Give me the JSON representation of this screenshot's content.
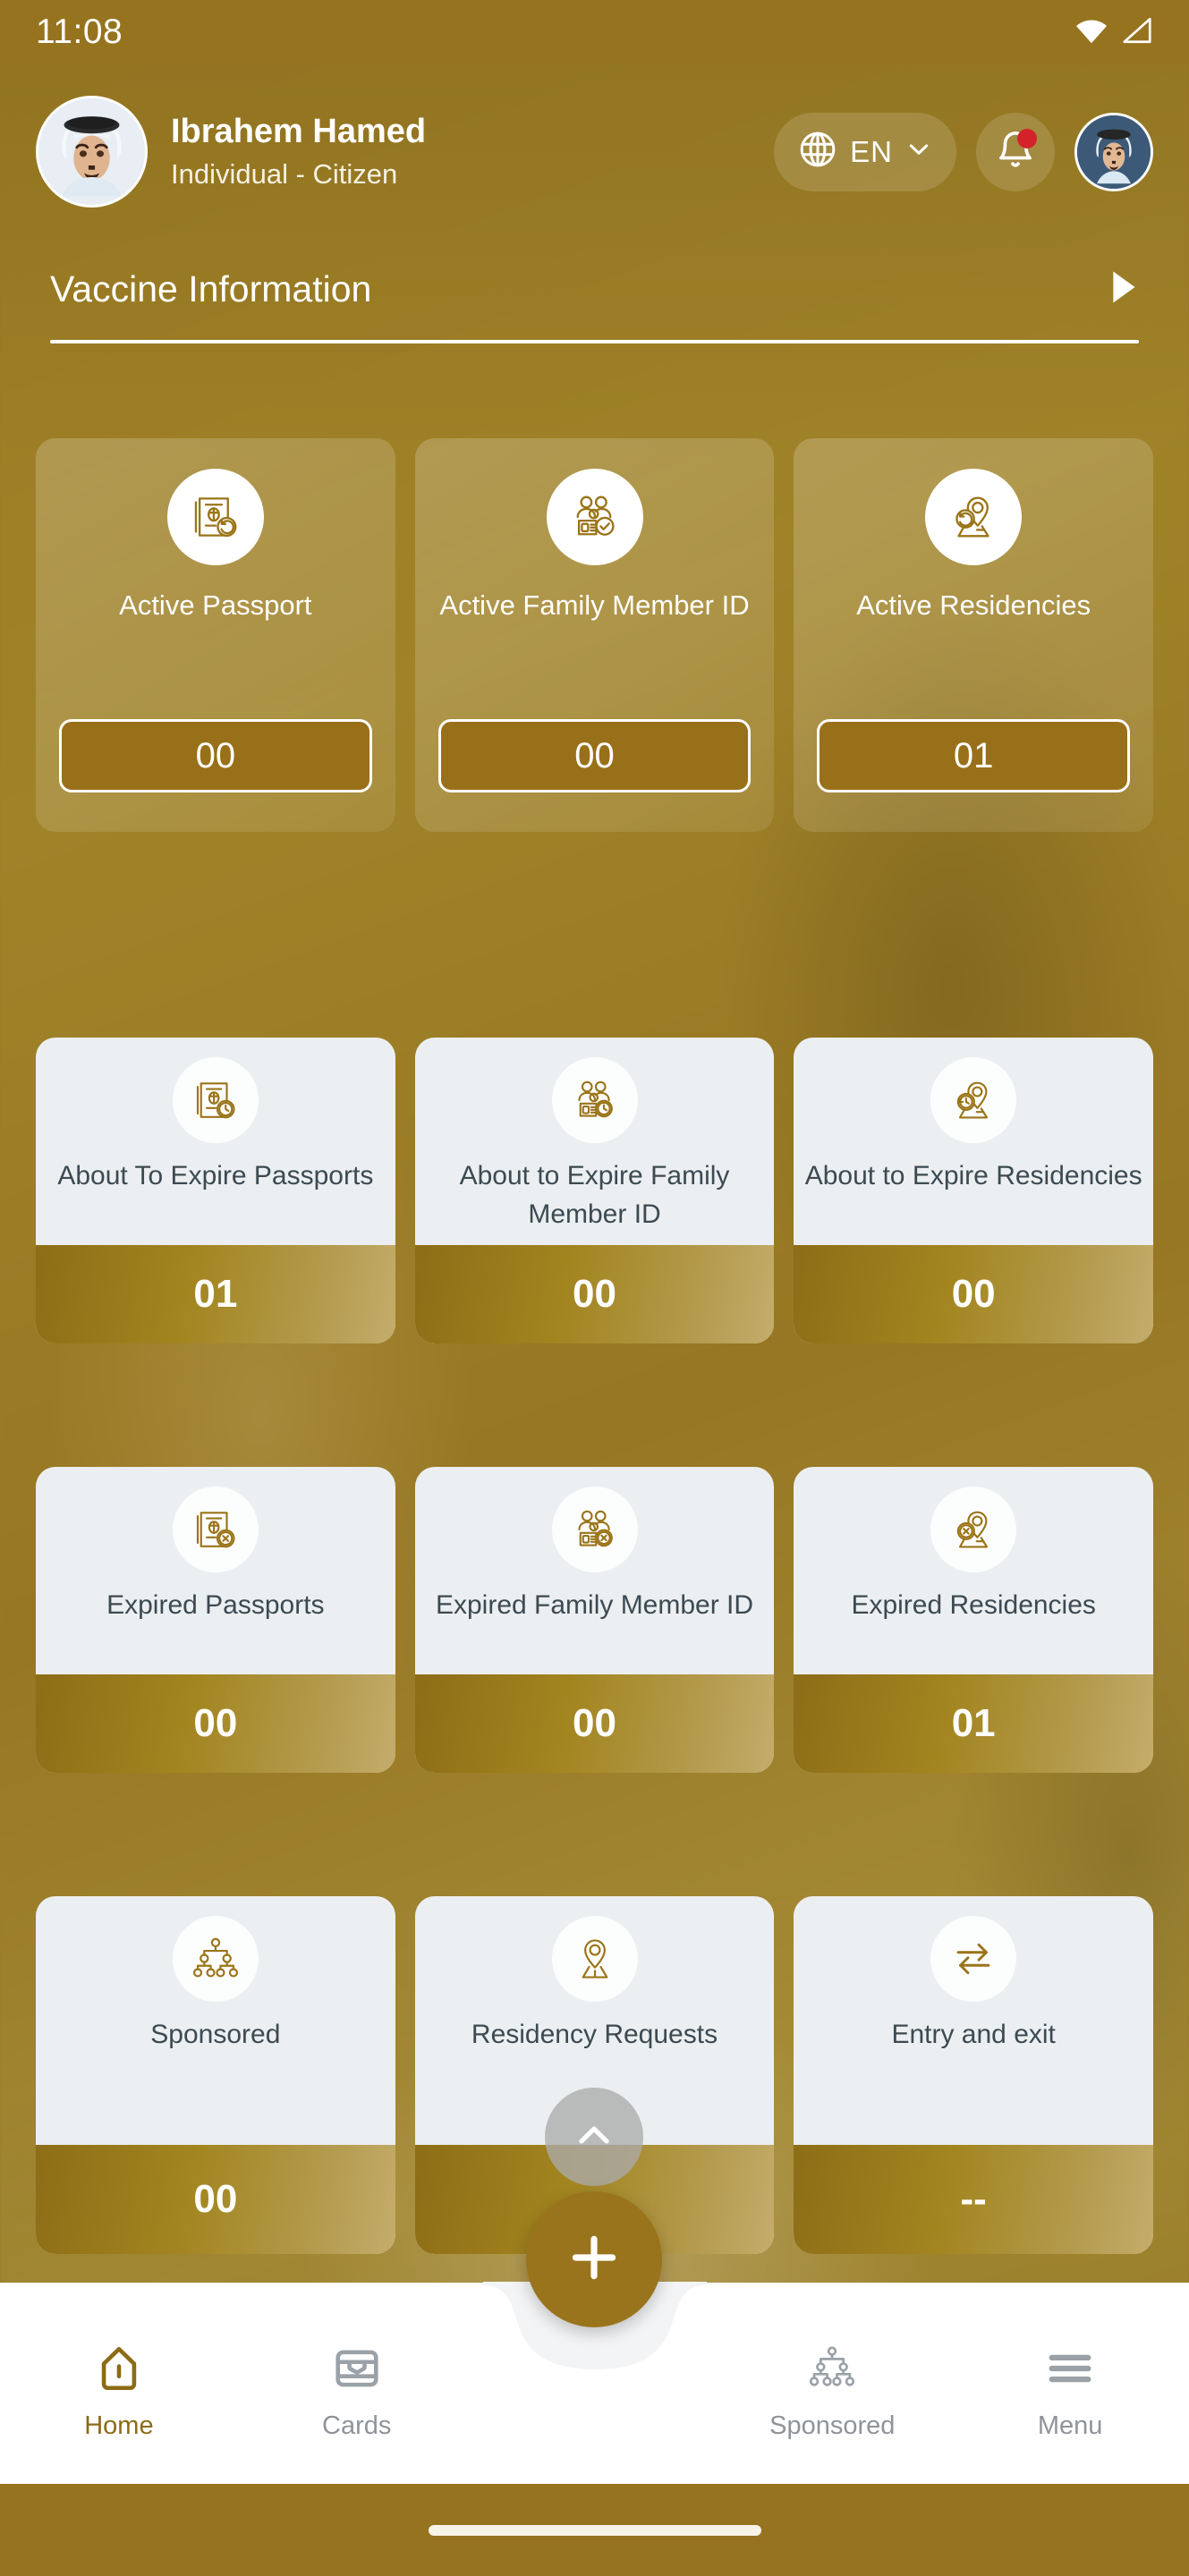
{
  "status_bar": {
    "time": "11:08",
    "wifi_icon": "wifi-icon",
    "signal_icon": "cellular-signal-icon"
  },
  "header": {
    "avatar_icon": "user-avatar",
    "user_name": "Ibrahem Hamed",
    "user_role": "Individual - Citizen",
    "language": {
      "globe_icon": "globe-icon",
      "code": "EN",
      "chevron_icon": "chevron-down-icon"
    },
    "notifications": {
      "bell_icon": "bell-icon",
      "has_unread": true,
      "badge_color": "#d4222a"
    },
    "profile_avatar_icon": "profile-avatar-icon"
  },
  "banner": {
    "title": "Vaccine Information",
    "play_icon": "play-triangle-icon"
  },
  "active_cards": [
    {
      "label": "Active Passport",
      "value": "00",
      "icon": "passport-refresh-icon"
    },
    {
      "label": "Active Family Member ID",
      "value": "00",
      "icon": "family-id-check-icon"
    },
    {
      "label": "Active Residencies",
      "value": "01",
      "icon": "residency-pin-refresh-icon"
    }
  ],
  "expiring_cards": [
    {
      "label": "About To Expire Passports",
      "value": "01",
      "icon": "passport-clock-icon"
    },
    {
      "label": "About to Expire Family Member ID",
      "value": "00",
      "icon": "family-id-clock-icon"
    },
    {
      "label": "About to Expire Residencies",
      "value": "00",
      "icon": "residency-pin-clock-icon"
    }
  ],
  "expired_cards": [
    {
      "label": "Expired Passports",
      "value": "00",
      "icon": "passport-x-icon"
    },
    {
      "label": "Expired Family Member ID",
      "value": "00",
      "icon": "family-id-x-icon"
    },
    {
      "label": "Expired Residencies",
      "value": "01",
      "icon": "residency-pin-x-icon"
    }
  ],
  "service_cards": [
    {
      "label": "Sponsored",
      "value": "00",
      "icon": "org-chart-icon"
    },
    {
      "label": "Residency Requests",
      "value": "",
      "icon": "location-pin-icon"
    },
    {
      "label": "Entry and exit",
      "value": "--",
      "icon": "entry-exit-arrows-icon"
    }
  ],
  "floating_buttons": {
    "scroll_top_icon": "chevron-up-icon",
    "add_icon": "plus-icon"
  },
  "bottom_nav": {
    "items": [
      {
        "label": "Home",
        "icon": "home-icon",
        "active": true
      },
      {
        "label": "Cards",
        "icon": "wallet-icon",
        "active": false
      },
      {
        "label": "Sponsored",
        "icon": "org-chart-icon",
        "active": false
      },
      {
        "label": "Menu",
        "icon": "hamburger-menu-icon",
        "active": false
      }
    ]
  },
  "colors": {
    "gold": "#96731f",
    "gold_light": "#c4ad6c",
    "card_white": "#eceff1",
    "text_dark": "#3c4a52",
    "accent_icon": "#8d6b16"
  }
}
